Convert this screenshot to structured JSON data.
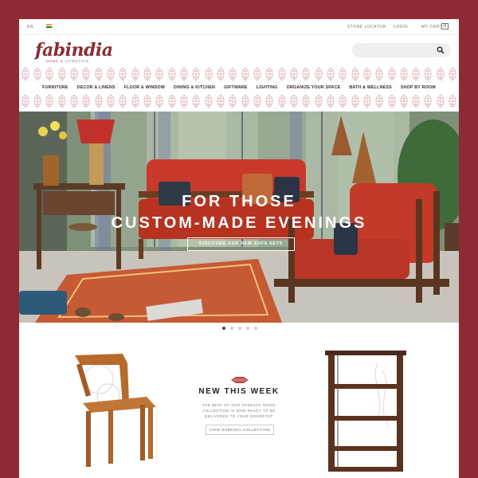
{
  "topbar": {
    "language": "EN",
    "store_locator": "STORE LOCATOR",
    "login": "LOGIN",
    "my_cart": "MY CART",
    "cart_count": "0"
  },
  "brand": {
    "logo": "fabindia",
    "tagline": "HOME & LIFESTYLE",
    "color": "#8e2a33"
  },
  "search": {
    "placeholder": ""
  },
  "nav": {
    "items": [
      "FURNITURE",
      "DECOR & LINENS",
      "FLOOR & WINDOW",
      "DINING & KITCHEN",
      "GIFTWARE",
      "LIGHTING",
      "ORGANIZE YOUR SPACE",
      "BATH & WELLNESS",
      "SHOP BY ROOM"
    ]
  },
  "hero": {
    "title_line1": "FOR THOSE",
    "title_line2": "CUSTOM-MADE EVENINGS",
    "cta": "DISCOVER OUR NEW SOFA SETS",
    "slide_count": 5,
    "active_slide": 1
  },
  "new_this_week": {
    "title": "NEW THIS WEEK",
    "description": "THE BEST OF OUR SHEESHA WOOD COLLECTION IS NOW READY TO BE DELIVERED TO YOUR DOORSTEP",
    "cta": "VIEW SHEESHA COLLECTION"
  },
  "icons": [
    "search-icon",
    "india-flag-icon",
    "arrow-ornament-icon"
  ]
}
